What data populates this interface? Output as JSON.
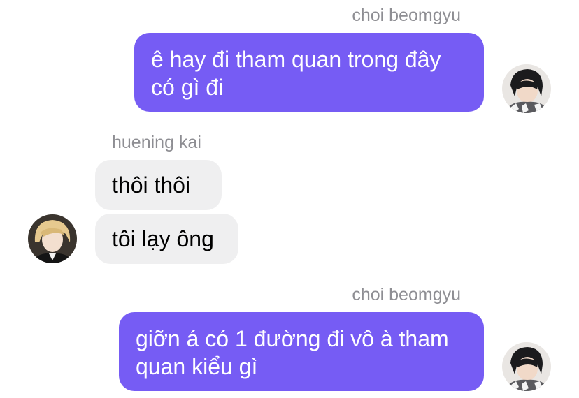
{
  "conversation": {
    "messages": [
      {
        "sender": "choi beomgyu",
        "lines": [
          "ê hay đi tham quan trong đây",
          "có gì đi"
        ],
        "direction": "outgoing"
      },
      {
        "sender": "huening kai",
        "direction": "incoming",
        "bubbles": [
          "thôi thôi",
          "tôi lạy ông"
        ]
      },
      {
        "sender": "choi beomgyu",
        "lines": [
          "giỡn á có 1 đường đi vô à tham",
          "quan kiểu gì"
        ],
        "direction": "outgoing"
      }
    ]
  },
  "avatars": {
    "beomgyu": "avatar-beomgyu-icon",
    "kai": "avatar-kai-icon"
  },
  "colors": {
    "outgoing_bubble": "#765cf4",
    "incoming_bubble": "#efeff0",
    "sender_name": "#8e8e93",
    "background": "#ffffff"
  }
}
